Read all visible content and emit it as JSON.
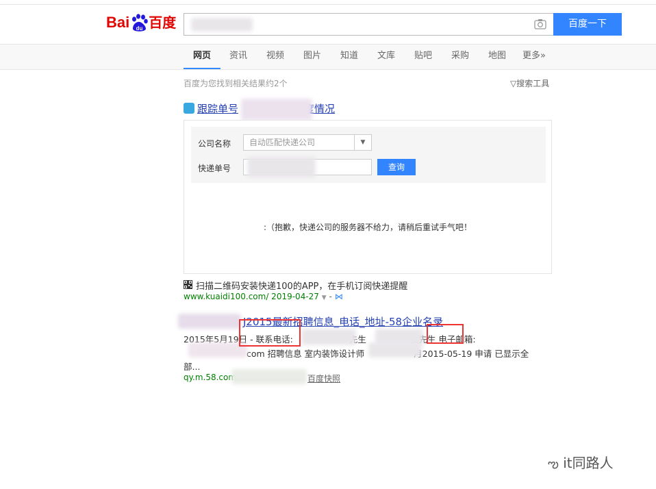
{
  "header": {
    "logo_bai": "Bai",
    "logo_du": "du",
    "logo_zh": "百度",
    "search_value": "",
    "search_button": "百度一下"
  },
  "nav": [
    "网页",
    "资讯",
    "视频",
    "图片",
    "知道",
    "文库",
    "贴吧",
    "采购",
    "地图",
    "更多»"
  ],
  "result_count": "百度为您找到相关结果约2个",
  "tools": "搜索工具",
  "result1": {
    "title_left": "跟踪单号",
    "title_right": "度情况",
    "form": {
      "company_label": "公司名称",
      "company_placeholder": "自动匹配快递公司",
      "number_label": "快递单号",
      "query_button": "查询"
    },
    "message": ":（抱歉，快递公司的服务器不给力，请稍后重试手气吧！",
    "qr_text": "扫描二维码安装快递100的APP，在手机订阅快递提醒",
    "url": "www.kuaidi100.com/ 2019-04-27"
  },
  "result2": {
    "title": "J2015最新招聘信息_电话_地址-58企业名录",
    "line1_a": "2015年5月19日 - 联系电话:",
    "line1_b": "先生",
    "line1_c": "吴先生",
    "line1_d": "电子邮箱:",
    "line2_a": "com 招聘信息 室内装饰设计师",
    "line2_b": "月2015-05-19 申请 已显示全",
    "line3": "部...",
    "url": "qy.m.58.com",
    "snapshot": "百度快照"
  },
  "watermark": "it同路人",
  "colors": {
    "accent": "#3385ff",
    "link": "#2440b3",
    "url": "#008000",
    "logo": "#e10602",
    "highlight_box": "#e33333"
  }
}
